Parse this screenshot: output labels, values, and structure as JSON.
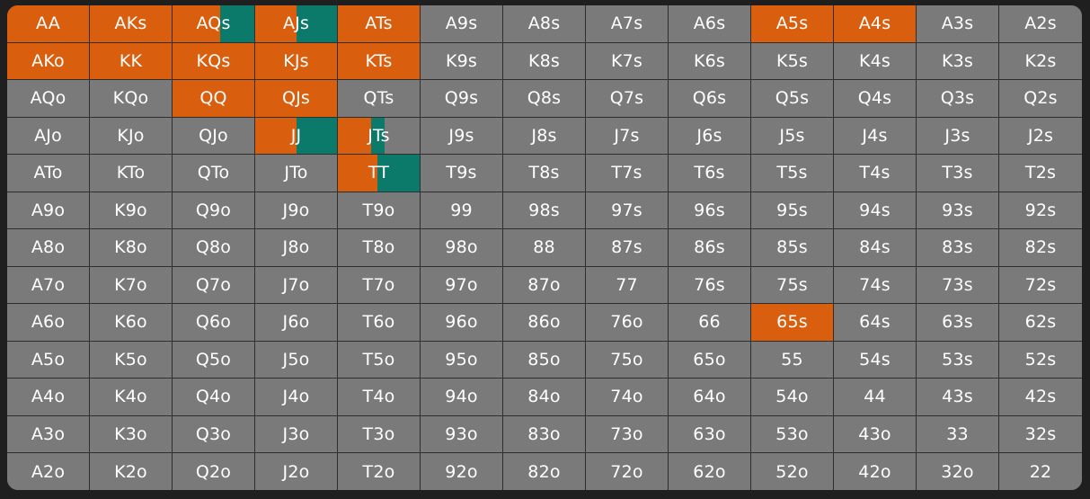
{
  "colors": {
    "raise": "#d95f0f",
    "call": "#0c7a6b",
    "fold": "#7a7a7a"
  },
  "grid": [
    [
      "AA",
      "AKs",
      "AQs",
      "AJs",
      "ATs",
      "A9s",
      "A8s",
      "A7s",
      "A6s",
      "A5s",
      "A4s",
      "A3s",
      "A2s"
    ],
    [
      "AKo",
      "KK",
      "KQs",
      "KJs",
      "KTs",
      "K9s",
      "K8s",
      "K7s",
      "K6s",
      "K5s",
      "K4s",
      "K3s",
      "K2s"
    ],
    [
      "AQo",
      "KQo",
      "QQ",
      "QJs",
      "QTs",
      "Q9s",
      "Q8s",
      "Q7s",
      "Q6s",
      "Q5s",
      "Q4s",
      "Q3s",
      "Q2s"
    ],
    [
      "AJo",
      "KJo",
      "QJo",
      "JJ",
      "JTs",
      "J9s",
      "J8s",
      "J7s",
      "J6s",
      "J5s",
      "J4s",
      "J3s",
      "J2s"
    ],
    [
      "ATo",
      "KTo",
      "QTo",
      "JTo",
      "TT",
      "T9s",
      "T8s",
      "T7s",
      "T6s",
      "T5s",
      "T4s",
      "T3s",
      "T2s"
    ],
    [
      "A9o",
      "K9o",
      "Q9o",
      "J9o",
      "T9o",
      "99",
      "98s",
      "97s",
      "96s",
      "95s",
      "94s",
      "93s",
      "92s"
    ],
    [
      "A8o",
      "K8o",
      "Q8o",
      "J8o",
      "T8o",
      "98o",
      "88",
      "87s",
      "86s",
      "85s",
      "84s",
      "83s",
      "82s"
    ],
    [
      "A7o",
      "K7o",
      "Q7o",
      "J7o",
      "T7o",
      "97o",
      "87o",
      "77",
      "76s",
      "75s",
      "74s",
      "73s",
      "72s"
    ],
    [
      "A6o",
      "K6o",
      "Q6o",
      "J6o",
      "T6o",
      "96o",
      "86o",
      "76o",
      "66",
      "65s",
      "64s",
      "63s",
      "62s"
    ],
    [
      "A5o",
      "K5o",
      "Q5o",
      "J5o",
      "T5o",
      "95o",
      "85o",
      "75o",
      "65o",
      "55",
      "54s",
      "53s",
      "52s"
    ],
    [
      "A4o",
      "K4o",
      "Q4o",
      "J4o",
      "T4o",
      "94o",
      "84o",
      "74o",
      "64o",
      "54o",
      "44",
      "43s",
      "42s"
    ],
    [
      "A3o",
      "K3o",
      "Q3o",
      "J3o",
      "T3o",
      "93o",
      "83o",
      "73o",
      "63o",
      "53o",
      "43o",
      "33",
      "32s"
    ],
    [
      "A2o",
      "K2o",
      "Q2o",
      "J2o",
      "T2o",
      "92o",
      "82o",
      "72o",
      "62o",
      "52o",
      "42o",
      "32o",
      "22"
    ]
  ],
  "actions": {
    "AA": {
      "raise": 1.0
    },
    "AKs": {
      "raise": 1.0
    },
    "AQs": {
      "raise": 0.58,
      "call": 0.42
    },
    "AJs": {
      "raise": 0.5,
      "call": 0.5
    },
    "ATs": {
      "raise": 1.0
    },
    "A5s": {
      "raise": 1.0
    },
    "A4s": {
      "raise": 1.0
    },
    "AKo": {
      "raise": 1.0
    },
    "KK": {
      "raise": 1.0
    },
    "KQs": {
      "raise": 1.0
    },
    "KJs": {
      "raise": 1.0
    },
    "KTs": {
      "raise": 1.0
    },
    "QQ": {
      "raise": 1.0
    },
    "QJs": {
      "raise": 1.0
    },
    "JJ": {
      "raise": 0.5,
      "call": 0.5
    },
    "JTs": {
      "raise": 0.41,
      "call": 0.16
    },
    "TT": {
      "raise": 0.48,
      "call": 0.52
    },
    "65s": {
      "raise": 1.0
    }
  }
}
